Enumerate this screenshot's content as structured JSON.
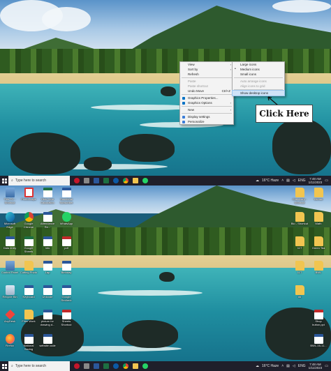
{
  "context_menu": {
    "main": [
      {
        "label": "View",
        "has_submenu": true
      },
      {
        "label": "Sort by",
        "has_submenu": true
      },
      {
        "label": "Refresh"
      },
      {
        "separator": true
      },
      {
        "label": "Paste",
        "disabled": true
      },
      {
        "label": "Paste shortcut",
        "disabled": true
      },
      {
        "label": "Undo Move",
        "shortcut": "Ctrl+Z"
      },
      {
        "separator": true
      },
      {
        "label": "Graphics Properties...",
        "icon": "intel-graphics-icon"
      },
      {
        "label": "Graphics Options",
        "icon": "intel-graphics-icon",
        "has_submenu": true
      },
      {
        "separator": true
      },
      {
        "label": "New",
        "has_submenu": true
      },
      {
        "separator": true
      },
      {
        "label": "Display settings",
        "icon": "display-settings-icon"
      },
      {
        "label": "Personalize",
        "icon": "personalize-icon"
      }
    ],
    "view_submenu": [
      {
        "label": "Large icons"
      },
      {
        "label": "Medium icons",
        "bullet": true
      },
      {
        "label": "Small icons"
      },
      {
        "separator": true
      },
      {
        "label": "Auto arrange icons",
        "disabled": true
      },
      {
        "label": "Align icons to grid",
        "disabled": true
      },
      {
        "separator": true
      },
      {
        "label": "Show desktop icons",
        "highlighted": true
      }
    ]
  },
  "callout": "Click Here",
  "taskbar": {
    "search_placeholder": "Type here to search",
    "weather": "16°C  Haze",
    "language": "ENG",
    "time": "7:48 AM",
    "date": "1/11/2023"
  },
  "desktop_icons_left": [
    {
      "label": "This PC - Shortcut",
      "type": "app",
      "col": 0,
      "row": 0
    },
    {
      "label": "PhotoScape",
      "type": "paint",
      "col": 1,
      "row": 0
    },
    {
      "label": "Click Here Calculation",
      "type": "excel",
      "col": 2,
      "row": 0
    },
    {
      "label": "Sumitbhai Subscriber",
      "type": "doc",
      "col": 3,
      "row": 0
    },
    {
      "label": "Microsoft Edge",
      "type": "edge",
      "col": 0,
      "row": 1
    },
    {
      "label": "Google Chrome",
      "type": "chrome",
      "col": 1,
      "row": 1
    },
    {
      "label": "Attendance Re...",
      "type": "doc",
      "col": 2,
      "row": 1
    },
    {
      "label": "WhatsApp",
      "type": "whatsapp",
      "col": 3,
      "row": 1
    },
    {
      "label": "Data entry",
      "type": "doc",
      "col": 0,
      "row": 2
    },
    {
      "label": "Google Sheets",
      "type": "excel",
      "col": 1,
      "row": 2
    },
    {
      "label": "Info",
      "type": "doc",
      "col": 2,
      "row": 2
    },
    {
      "label": "pdf",
      "type": "pdf",
      "col": 3,
      "row": 2
    },
    {
      "label": "Control Panel",
      "type": "app",
      "col": 0,
      "row": 3
    },
    {
      "label": "Cutting Photo",
      "type": "folder",
      "col": 1,
      "row": 3
    },
    {
      "label": "1ap",
      "type": "doc",
      "col": 2,
      "row": 3
    },
    {
      "label": "Birthday",
      "type": "doc",
      "col": 3,
      "row": 3
    },
    {
      "label": "Recycle Bin",
      "type": "recycle",
      "col": 0,
      "row": 4
    },
    {
      "label": "Keyboard",
      "type": "doc",
      "col": 1,
      "row": 4
    },
    {
      "label": "Unicode",
      "type": "doc",
      "col": 2,
      "row": 4
    },
    {
      "label": "Google Redirect",
      "type": "doc",
      "col": 3,
      "row": 4
    },
    {
      "label": "AnyDesk",
      "type": "anydesk",
      "col": 0,
      "row": 5
    },
    {
      "label": "Filter Work",
      "type": "folder",
      "col": 1,
      "row": 5
    },
    {
      "label": "picture for drawing d...",
      "type": "doc",
      "col": 2,
      "row": 5
    },
    {
      "label": "Sheets Shortcut",
      "type": "pdf",
      "col": 3,
      "row": 5
    },
    {
      "label": "Firefox",
      "type": "firefox",
      "col": 0,
      "row": 6
    },
    {
      "label": "National Saving",
      "type": "doc",
      "col": 1,
      "row": 6
    },
    {
      "label": "website code",
      "type": "doc",
      "col": 2,
      "row": 6
    }
  ],
  "desktop_icons_right": [
    {
      "label": "Chemistry - Shortcut",
      "type": "folder",
      "col": 0,
      "row": 0
    },
    {
      "label": "Usman",
      "type": "folder",
      "col": 1,
      "row": 0
    },
    {
      "label": "Bio - Shortcut",
      "type": "folder",
      "col": 0,
      "row": 1
    },
    {
      "label": "Math",
      "type": "folder",
      "col": 1,
      "row": 1
    },
    {
      "label": "11T",
      "type": "folder",
      "col": 0,
      "row": 2
    },
    {
      "label": "Green Tea",
      "type": "folder",
      "col": 1,
      "row": 2
    },
    {
      "label": "11T",
      "type": "folder",
      "col": 0,
      "row": 3
    },
    {
      "label": "BWL",
      "type": "folder",
      "col": 1,
      "row": 3
    },
    {
      "label": "dd",
      "type": "folder",
      "col": 0,
      "row": 4
    },
    {
      "label": "Shop button.ppt",
      "type": "pdf",
      "col": 1,
      "row": 5
    },
    {
      "label": "BWL-16-11...",
      "type": "doc",
      "col": 1,
      "row": 6
    }
  ]
}
